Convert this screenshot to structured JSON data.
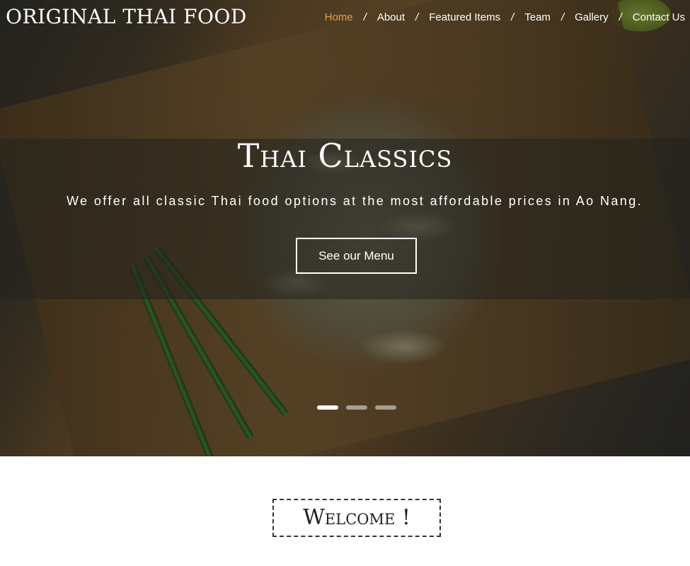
{
  "brand": {
    "name": "ORIGINAL THAI FOOD"
  },
  "nav": {
    "items": [
      {
        "label": "Home",
        "active": true
      },
      {
        "label": "About",
        "active": false
      },
      {
        "label": "Featured Items",
        "active": false
      },
      {
        "label": "Team",
        "active": false
      },
      {
        "label": "Gallery",
        "active": false
      },
      {
        "label": "Contact Us",
        "active": false
      }
    ],
    "separator": "/",
    "active_color": "#e2a14a"
  },
  "hero": {
    "title": "Thai Classics",
    "text": "We offer all classic Thai food options at the most affordable prices in Ao Nang.",
    "button_label": "See our Menu",
    "slides_total": 3,
    "active_slide": 1
  },
  "welcome": {
    "title": "Welcome !"
  }
}
